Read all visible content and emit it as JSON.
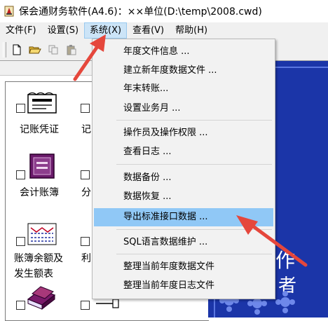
{
  "window": {
    "title": "保会通财务软件(A4.6)：××单位(D:\\temp\\2008.cwd)",
    "app_icon": "app-icon"
  },
  "menubar": {
    "items": [
      {
        "label": "文件(F)"
      },
      {
        "label": "设置(S)"
      },
      {
        "label": "系统(X)",
        "active": true
      },
      {
        "label": "查看(V)"
      },
      {
        "label": "帮助(H)"
      }
    ]
  },
  "toolbar": {
    "buttons": [
      "new-document-icon",
      "open-folder-icon",
      "copy-icon",
      "paste-icon"
    ]
  },
  "modules": [
    {
      "label_line1": "记账凭证",
      "label_line2": "",
      "icon": "voucher-icon"
    },
    {
      "label_line1": "记",
      "label_line2": "",
      "icon": "voucher-icon"
    },
    {
      "label_line1": "会计账簿",
      "label_line2": "",
      "icon": "ledger-book-icon"
    },
    {
      "label_line1": "分",
      "label_line2": "",
      "icon": "ledger-icon"
    },
    {
      "label_line1": "账簿余额及",
      "label_line2": "发生额表",
      "icon": "balance-table-icon"
    },
    {
      "label_line1": "利",
      "label_line2": "",
      "icon": "profit-icon"
    },
    {
      "label_line1": "",
      "label_line2": "",
      "icon": "book-stack-icon"
    },
    {
      "label_line1": "",
      "label_line2": "",
      "icon": "tool-icon"
    }
  ],
  "system_menu": {
    "groups": [
      [
        {
          "label": "年度文件信息 ..."
        },
        {
          "label": "建立新年度数据文件 ..."
        },
        {
          "label": "年末转账..."
        },
        {
          "label": "设置业务月 ..."
        }
      ],
      [
        {
          "label": "操作员及操作权限 ..."
        },
        {
          "label": "查看日志 ..."
        }
      ],
      [
        {
          "label": "数据备份 ..."
        },
        {
          "label": "数据恢复 ..."
        },
        {
          "label": "导出标准接口数据 ...",
          "highlighted": true
        }
      ],
      [
        {
          "label": "SQL语言数据维护 ..."
        }
      ],
      [
        {
          "label": "整理当前年度数据文件"
        },
        {
          "label": "整理当前年度日志文件"
        }
      ]
    ]
  },
  "background_text": {
    "chars": [
      "作",
      "者"
    ]
  },
  "colors": {
    "menu_highlight": "#90c8f6",
    "menubar_active": "#cce4f7",
    "right_panel": "#1b35a8",
    "arrow": "#e5473c"
  }
}
